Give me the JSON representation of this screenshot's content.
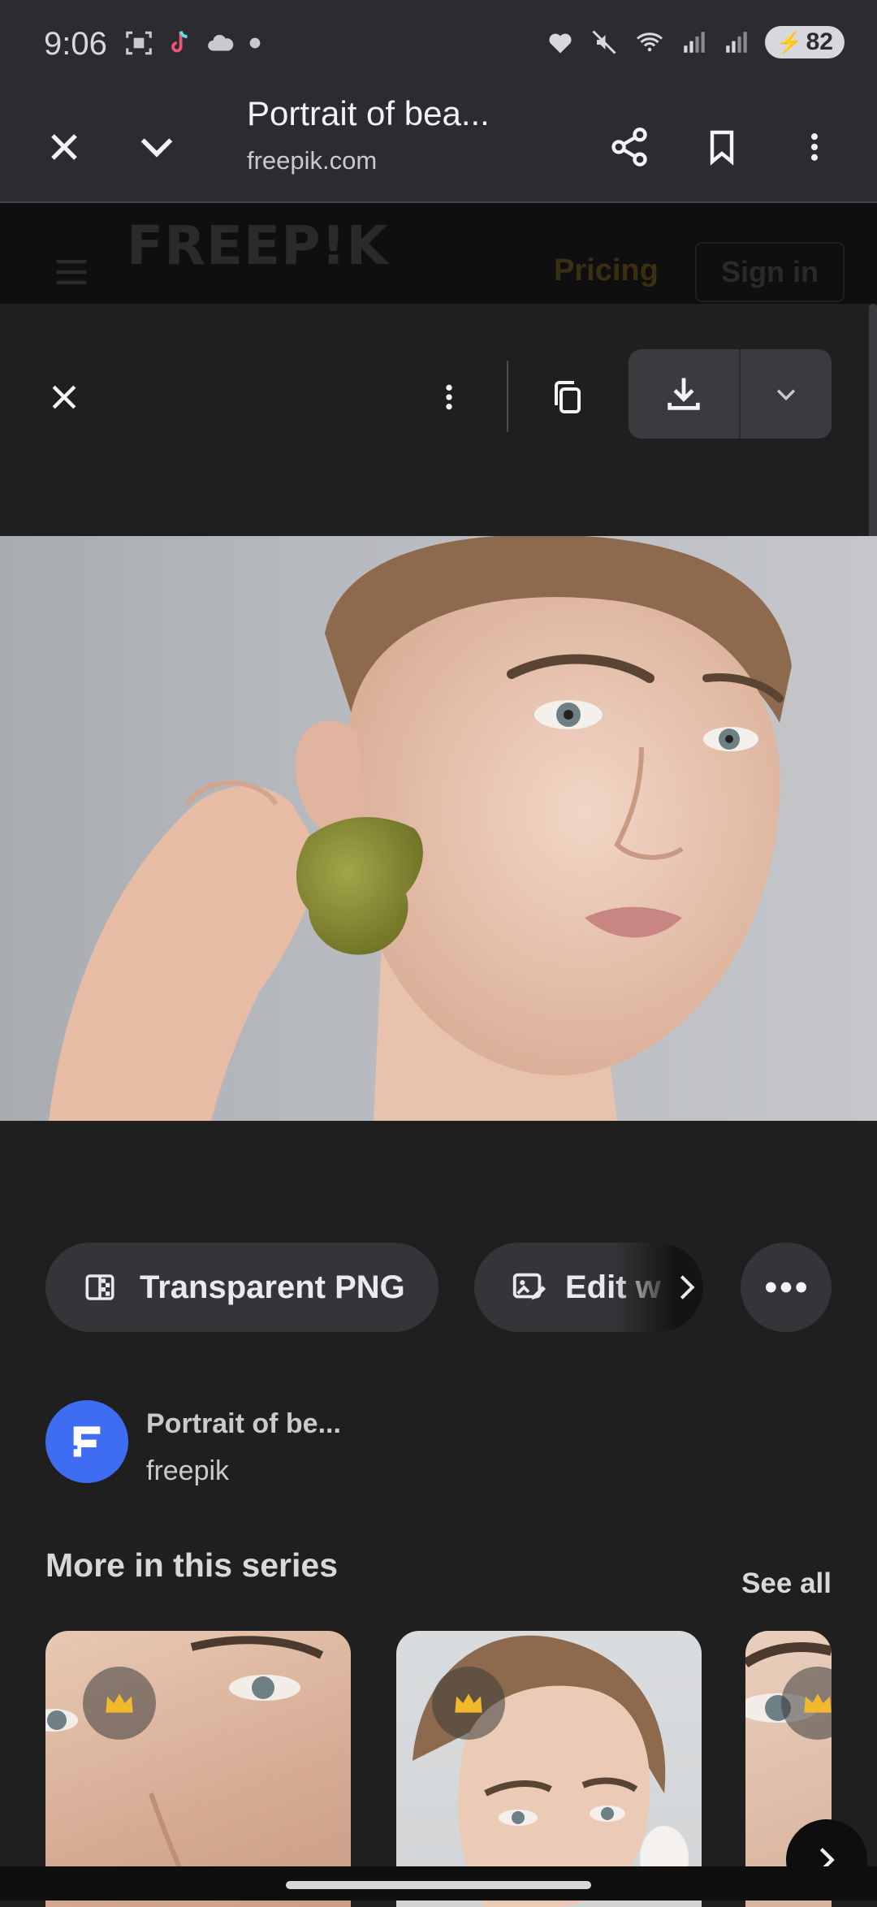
{
  "status_bar": {
    "time": "9:06",
    "battery": "82",
    "left_icons": [
      "screenshot-icon",
      "tiktok-icon",
      "cloud-icon",
      "dot-icon"
    ],
    "right_icons": [
      "heart-icon",
      "mute-icon",
      "wifi-icon",
      "signal-icon",
      "signal-icon",
      "battery-icon"
    ]
  },
  "browser_toolbar": {
    "title": "Portrait of bea...",
    "url": "freepik.com"
  },
  "site_header": {
    "logo": "FREEP!K",
    "pricing": "Pricing",
    "sign_in": "Sign in"
  },
  "chips": {
    "transparent_png": "Transparent PNG",
    "edit": "Edit w"
  },
  "source": {
    "title": "Portrait of be...",
    "name": "freepik"
  },
  "series": {
    "title": "More in this series",
    "see_all": "See all"
  },
  "colors": {
    "background": "#1f1f1f",
    "toolbar": "#2b2c30",
    "avatar": "#3e6df2",
    "crown": "#f2b92c"
  }
}
